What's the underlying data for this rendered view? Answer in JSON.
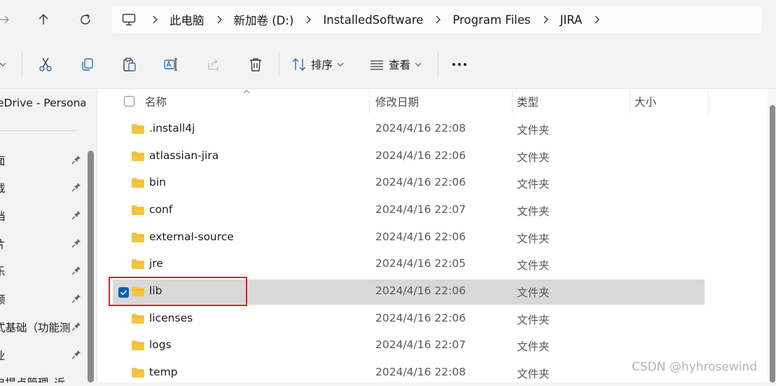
{
  "address": {
    "crumbs": [
      "此电脑",
      "新加卷 (D:)",
      "InstalledSoftware",
      "Program Files",
      "JIRA"
    ]
  },
  "toolbar": {
    "sort_label": "排序",
    "view_label": "查看"
  },
  "sidebar": {
    "onedrive_label": "eDrive - Personal",
    "pinned": [
      "面",
      "载",
      "档",
      "片",
      "乐",
      "频",
      "式基础（功能测试）",
      "业",
      "自提点管理_近"
    ]
  },
  "columns": {
    "name": "名称",
    "modified": "修改日期",
    "type": "类型",
    "size": "大小"
  },
  "rows": [
    {
      "name": ".install4j",
      "modified": "2024/4/16 22:08",
      "type": "文件夹",
      "selected": false
    },
    {
      "name": "atlassian-jira",
      "modified": "2024/4/16 22:06",
      "type": "文件夹",
      "selected": false
    },
    {
      "name": "bin",
      "modified": "2024/4/16 22:06",
      "type": "文件夹",
      "selected": false
    },
    {
      "name": "conf",
      "modified": "2024/4/16 22:07",
      "type": "文件夹",
      "selected": false
    },
    {
      "name": "external-source",
      "modified": "2024/4/16 22:06",
      "type": "文件夹",
      "selected": false
    },
    {
      "name": "jre",
      "modified": "2024/4/16 22:05",
      "type": "文件夹",
      "selected": false
    },
    {
      "name": "lib",
      "modified": "2024/4/16 22:06",
      "type": "文件夹",
      "selected": true
    },
    {
      "name": "licenses",
      "modified": "2024/4/16 22:06",
      "type": "文件夹",
      "selected": false
    },
    {
      "name": "logs",
      "modified": "2024/4/16 22:07",
      "type": "文件夹",
      "selected": false
    },
    {
      "name": "temp",
      "modified": "2024/4/16 22:08",
      "type": "文件夹",
      "selected": false
    }
  ],
  "watermark": "CSDN @hyhrosewind",
  "colors": {
    "accent": "#005fb8",
    "folder": "#f4c542",
    "highlight": "#e0202a",
    "selection": "#d9d9d9"
  }
}
